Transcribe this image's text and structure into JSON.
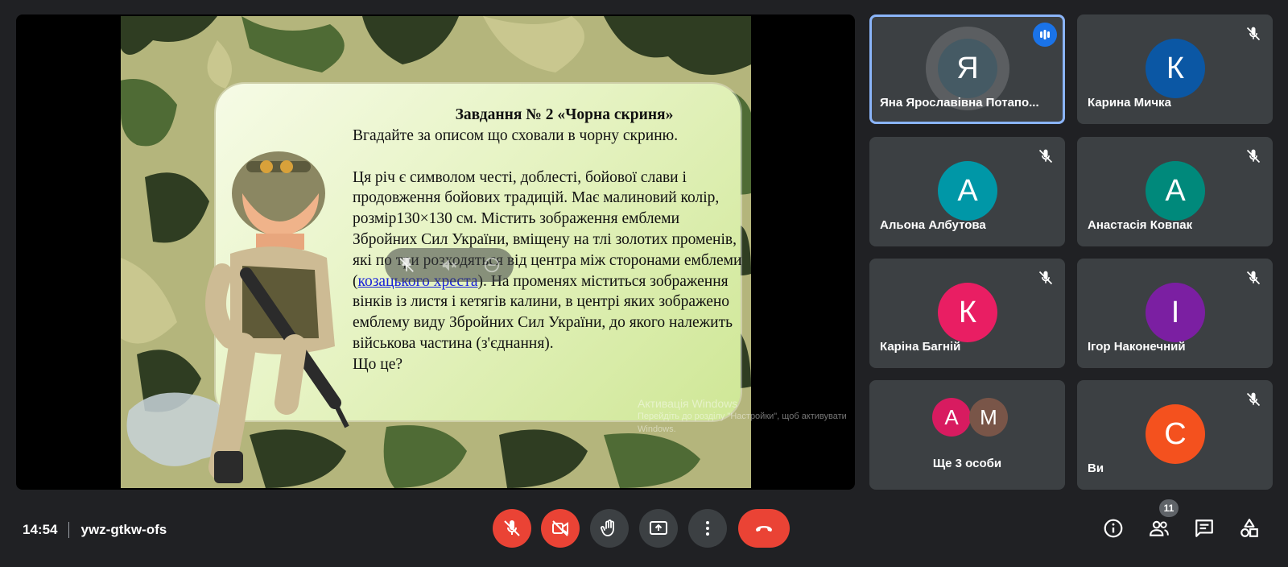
{
  "presentation": {
    "slide": {
      "title": "Завдання № 2 «Чорна скриня»",
      "subtitle": "Вгадайте за описом що сховали в чорну скриню.",
      "body_before_link": "Ця річ є символом честі, доблесті, бойової слави і продовження бойових традицій.  Має малиновий колір, розмір130×130 см. Містить зображення емблеми  Збройних Сил України, вміщену на тлі золотих променів, які по три розходяться від центра між сторонами емблеми (",
      "link_text": "козацького хреста",
      "body_after_link": "). На променях міститься зображення вінків із листя і кетягів калини, в центрі яких зображено емблему виду Збройних Сил України, до якого належить військова частина (з'єднання).",
      "question": "Що це?"
    },
    "watermark": {
      "line1": "Активація Windows",
      "line2": "Перейдіть до розділу \"Настройки\", щоб активувати Windows."
    }
  },
  "participants": [
    {
      "initial": "Я",
      "name": "Яна Ярославівна Потапо...",
      "color": "#455a64",
      "speaking": true,
      "muted": false
    },
    {
      "initial": "К",
      "name": "Карина Мичка",
      "color": "#0b57a4",
      "muted": true
    },
    {
      "initial": "А",
      "name": "Альона Албутова",
      "color": "#0097a7",
      "muted": true
    },
    {
      "initial": "А",
      "name": "Анастасія Ковпак",
      "color": "#00897b",
      "muted": true
    },
    {
      "initial": "К",
      "name": "Каріна Багній",
      "color": "#e91e63",
      "muted": true
    },
    {
      "initial": "І",
      "name": "Ігор Наконечний",
      "color": "#7b1fa2",
      "muted": true
    },
    {
      "initial": "С",
      "name": "Ви",
      "color": "#f4511e",
      "muted": true
    }
  ],
  "more_tile": {
    "avatars": [
      {
        "initial": "А",
        "color": "#d81b60"
      },
      {
        "initial": "М",
        "color": "#795548"
      }
    ],
    "label": "Ще 3 особи"
  },
  "bottom_bar": {
    "time": "14:54",
    "meeting_code": "ywz-gtkw-ofs",
    "participants_count": "11"
  },
  "icons": {
    "mic": "mic-off-icon",
    "camera": "camera-off-icon",
    "hand": "raise-hand-icon",
    "present": "present-screen-icon",
    "more": "more-options-icon",
    "hangup": "hang-up-icon",
    "info": "info-icon",
    "people": "people-icon",
    "chat": "chat-icon",
    "activities": "activities-icon"
  },
  "colors": {
    "background": "#202124",
    "tile": "#3c4043",
    "danger": "#ea4335",
    "active_border": "#8ab4f8",
    "speaking": "#1a73e8"
  }
}
